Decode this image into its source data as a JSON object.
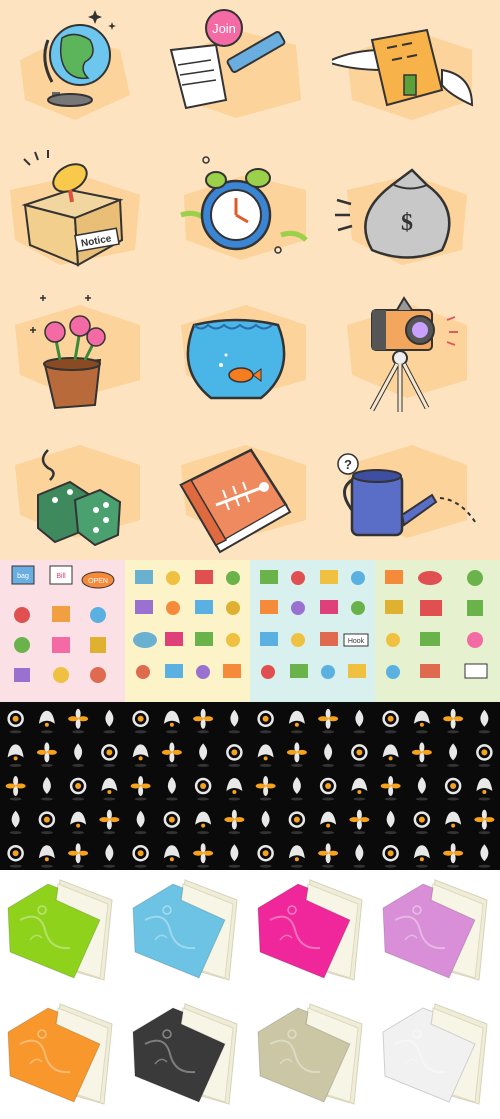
{
  "cartoon_icons": {
    "background": "#fde3bf",
    "blob_color": "#fbd39b",
    "row1": [
      {
        "name": "globe",
        "label": ""
      },
      {
        "name": "join-sign-up",
        "label": "Join"
      },
      {
        "name": "winged-building",
        "label": ""
      }
    ],
    "row2": [
      {
        "name": "notice-box",
        "label": "Notice"
      },
      {
        "name": "alarm-clock",
        "label": ""
      },
      {
        "name": "money-bag",
        "label": "$"
      }
    ],
    "row3": [
      {
        "name": "flower-pot",
        "label": ""
      },
      {
        "name": "fishbowl",
        "label": ""
      },
      {
        "name": "camera-tripod",
        "label": ""
      }
    ],
    "row4": [
      {
        "name": "dice",
        "label": ""
      },
      {
        "name": "fishbone-book",
        "label": ""
      },
      {
        "name": "watering-can",
        "label": "?"
      }
    ]
  },
  "preview_panels": [
    {
      "bg": "#fbe0e6",
      "labels": [
        "bag",
        "Bill",
        "OPEN"
      ]
    },
    {
      "bg": "#fdf3c8",
      "labels": []
    },
    {
      "bg": "#d8f0ee",
      "labels": [
        "Hook"
      ]
    },
    {
      "bg": "#e6f2cf",
      "labels": []
    }
  ],
  "symbol_grid": {
    "background": "#0a0a0a",
    "colors": [
      "#f7a21b",
      "#e8e8e8"
    ],
    "rows": 5,
    "cols": 16
  },
  "folders": [
    {
      "name": "folder-green",
      "color": "#8ed21c"
    },
    {
      "name": "folder-blue",
      "color": "#6cc3e4"
    },
    {
      "name": "folder-pink",
      "color": "#f0279a"
    },
    {
      "name": "folder-lilac",
      "color": "#d98fd8"
    },
    {
      "name": "folder-orange",
      "color": "#f8972b"
    },
    {
      "name": "folder-black",
      "color": "#3a3a3a"
    },
    {
      "name": "folder-khaki",
      "color": "#cbc6a4"
    },
    {
      "name": "folder-white",
      "color": "#f1f1f1"
    }
  ]
}
